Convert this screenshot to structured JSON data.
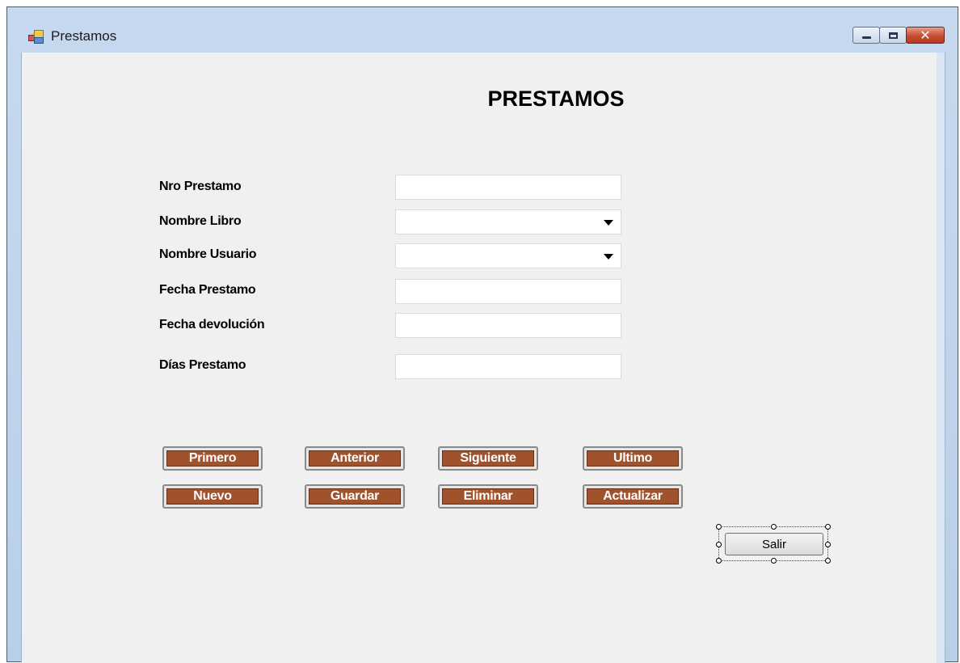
{
  "window": {
    "title": "Prestamos",
    "controls": {
      "minimize": "minimize-icon",
      "maximize": "maximize-icon",
      "close": "close-icon"
    }
  },
  "form": {
    "heading": "PRESTAMOS",
    "fields": [
      {
        "label": "Nro Prestamo",
        "type": "text",
        "value": ""
      },
      {
        "label": "Nombre Libro",
        "type": "combo",
        "value": ""
      },
      {
        "label": "Nombre Usuario",
        "type": "combo",
        "value": ""
      },
      {
        "label": "Fecha Prestamo",
        "type": "text",
        "value": ""
      },
      {
        "label": "Fecha devolución",
        "type": "text",
        "value": ""
      },
      {
        "label": "Días Prestamo",
        "type": "text",
        "value": ""
      }
    ],
    "nav_buttons": [
      "Primero",
      "Anterior",
      "Siguiente",
      "Ultimo"
    ],
    "action_buttons": [
      "Nuevo",
      "Guardar",
      "Eliminar",
      "Actualizar"
    ],
    "exit_button": "Salir"
  },
  "colors": {
    "button_face": "#a0522d",
    "form_background": "#f0f0f0",
    "title_bar": "#c6d9ef",
    "close_button": "#c74b30"
  }
}
